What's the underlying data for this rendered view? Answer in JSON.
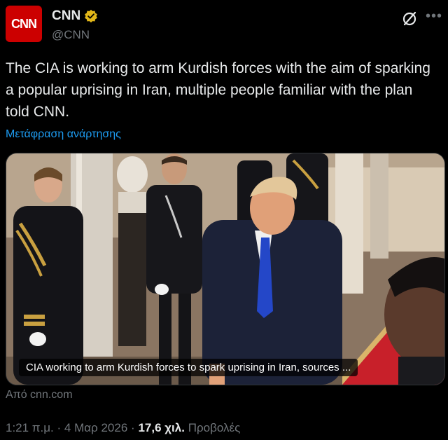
{
  "post": {
    "author_name": "CNN",
    "author_handle": "@CNN",
    "avatar_text": "CNN",
    "text": "The CIA is working to arm Kurdish forces with the aim of sparking a popular uprising in Iran, multiple people familiar with the plan told CNN.",
    "translate_label": "Μετάφραση ανάρτησης",
    "card_caption": "CIA working to arm Kurdish forces to spark uprising in Iran, sources ...",
    "card_source": "Από cnn.com",
    "time": "1:21 π.μ.",
    "date": "4 Μαρ 2026",
    "views_count": "17,6 χιλ.",
    "views_label": "Προβολές",
    "separator": "·"
  },
  "colors": {
    "background": "#000000",
    "text": "#e7e9ea",
    "muted": "#71767b",
    "link": "#1d9bf0",
    "verified_badge": "#e2b719",
    "brand": "#cc0000"
  },
  "icons": {
    "verified": "verified-badge-icon",
    "grok": "grok-icon",
    "more": "more-icon"
  }
}
